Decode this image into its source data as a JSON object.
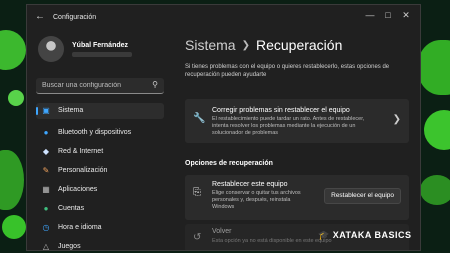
{
  "window": {
    "title": "Configuración",
    "back_icon": "back-arrow-icon",
    "controls": [
      "minimize-icon",
      "maximize-icon",
      "close-icon"
    ]
  },
  "user": {
    "name": "Yúbal Fernández"
  },
  "search": {
    "placeholder": "Buscar una configuración",
    "icon": "search-icon"
  },
  "sidebar": {
    "items": [
      {
        "label": "Sistema",
        "icon": "system-icon",
        "active": true,
        "color": "#3ea6ff"
      },
      {
        "label": "Bluetooth y dispositivos",
        "icon": "bluetooth-icon",
        "color": "#3ea6ff"
      },
      {
        "label": "Red & Internet",
        "icon": "wifi-icon",
        "color": "#cfe3ff"
      },
      {
        "label": "Personalización",
        "icon": "brush-icon",
        "color": "#f0a35e"
      },
      {
        "label": "Aplicaciones",
        "icon": "apps-icon",
        "color": "#bbbbbb"
      },
      {
        "label": "Cuentas",
        "icon": "account-icon",
        "color": "#3fbf7f"
      },
      {
        "label": "Hora e idioma",
        "icon": "globe-clock-icon",
        "color": "#3ea6ff"
      },
      {
        "label": "Juegos",
        "icon": "gamepad-icon",
        "color": "#bbbbbb"
      }
    ]
  },
  "main": {
    "breadcrumb_parent": "Sistema",
    "breadcrumb_current": "Recuperación",
    "intro": "Si tienes problemas con el equipo o quieres restablecerlo, estas opciones de recuperación pueden ayudarte",
    "troubleshoot": {
      "title": "Corregir problemas sin restablecer el equipo",
      "description": "El restablecimiento puede tardar un rato. Antes de restablecer, intenta resolver los problemas mediante la ejecución de un solucionador de problemas",
      "icon": "wrench-icon"
    },
    "section_title": "Opciones de recuperación",
    "reset": {
      "title": "Restablecer este equipo",
      "description": "Elige conservar o quitar tus archivos personales y, después, reinstala Windows",
      "button_label": "Restablecer el equipo",
      "icon": "reset-pc-icon"
    },
    "goback": {
      "title": "Volver",
      "description": "Esta opción ya no está disponible en este equipo",
      "icon": "history-icon"
    }
  },
  "watermark": {
    "text": "XATAKA BASICS"
  },
  "colors": {
    "accent": "#3ea6ff",
    "window_bg": "#202020",
    "card_bg": "#2b2b2b",
    "wallpaper": "#0b1f14"
  }
}
